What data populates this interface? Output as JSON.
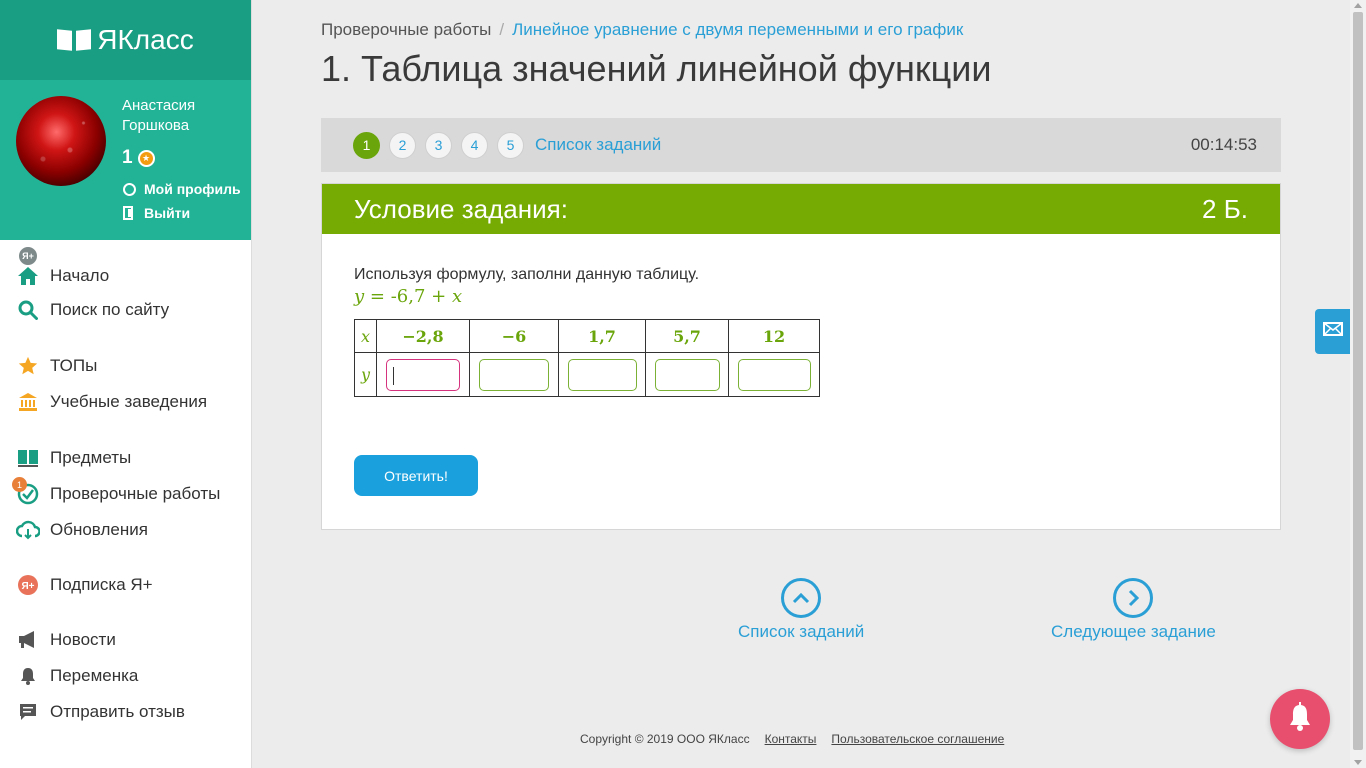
{
  "brand": {
    "logo_text": "ЯКласс"
  },
  "user": {
    "name": "Анастасия Горшкова",
    "points": "1",
    "profile_label": "Мой профиль",
    "logout_label": "Выйти",
    "badge_text": "Я+"
  },
  "nav": {
    "items": [
      {
        "label": "Начало",
        "icon": "home-icon"
      },
      {
        "label": "Поиск по сайту",
        "icon": "search-icon"
      },
      {
        "label": "ТОПы",
        "icon": "star-icon"
      },
      {
        "label": "Учебные заведения",
        "icon": "institution-icon"
      },
      {
        "label": "Предметы",
        "icon": "books-icon"
      },
      {
        "label": "Проверочные работы",
        "icon": "check-circle-icon",
        "badge": "1"
      },
      {
        "label": "Обновления",
        "icon": "cloud-update-icon"
      },
      {
        "label": "Подписка Я+",
        "icon": "subscription-icon"
      },
      {
        "label": "Новости",
        "icon": "megaphone-icon"
      },
      {
        "label": "Переменка",
        "icon": "bell-icon"
      },
      {
        "label": "Отправить отзыв",
        "icon": "feedback-icon"
      }
    ]
  },
  "breadcrumb": {
    "root": "Проверочные работы",
    "separator": "/",
    "current": "Линейное уравнение с двумя переменными и его график"
  },
  "page_title": "1. Таблица значений линейной функции",
  "task_bar": {
    "steps": [
      "1",
      "2",
      "3",
      "4",
      "5"
    ],
    "active_step": "1",
    "task_list_label": "Список заданий",
    "timer": "00:14:53"
  },
  "task": {
    "header": "Условие задания:",
    "points": "2 Б.",
    "instruction": "Используя формулу, заполни данную таблицу.",
    "formula": {
      "lhs": "y",
      "eq": " = ",
      "const": "-6,7",
      "plus": " + ",
      "var": "x"
    },
    "table": {
      "x_label": "x",
      "y_label": "y",
      "x_values": [
        "−2,8",
        "−6",
        "1,7",
        "5,7",
        "12"
      ],
      "y_values": [
        "",
        "",
        "",
        "",
        ""
      ]
    },
    "answer_button": "Ответить!"
  },
  "bottom_nav": {
    "task_list": "Список заданий",
    "next_task": "Следующее задание"
  },
  "footer": {
    "copyright": "Copyright © 2019 ООО ЯКласс",
    "contacts": "Контакты",
    "agreement": "Пользовательское соглашение"
  },
  "colors": {
    "brand_green": "#1a9e83",
    "task_header_green": "#76ab03",
    "link_blue": "#2a9fd6",
    "button_blue": "#1aa0dc",
    "bell_pink": "#e84f6e"
  }
}
